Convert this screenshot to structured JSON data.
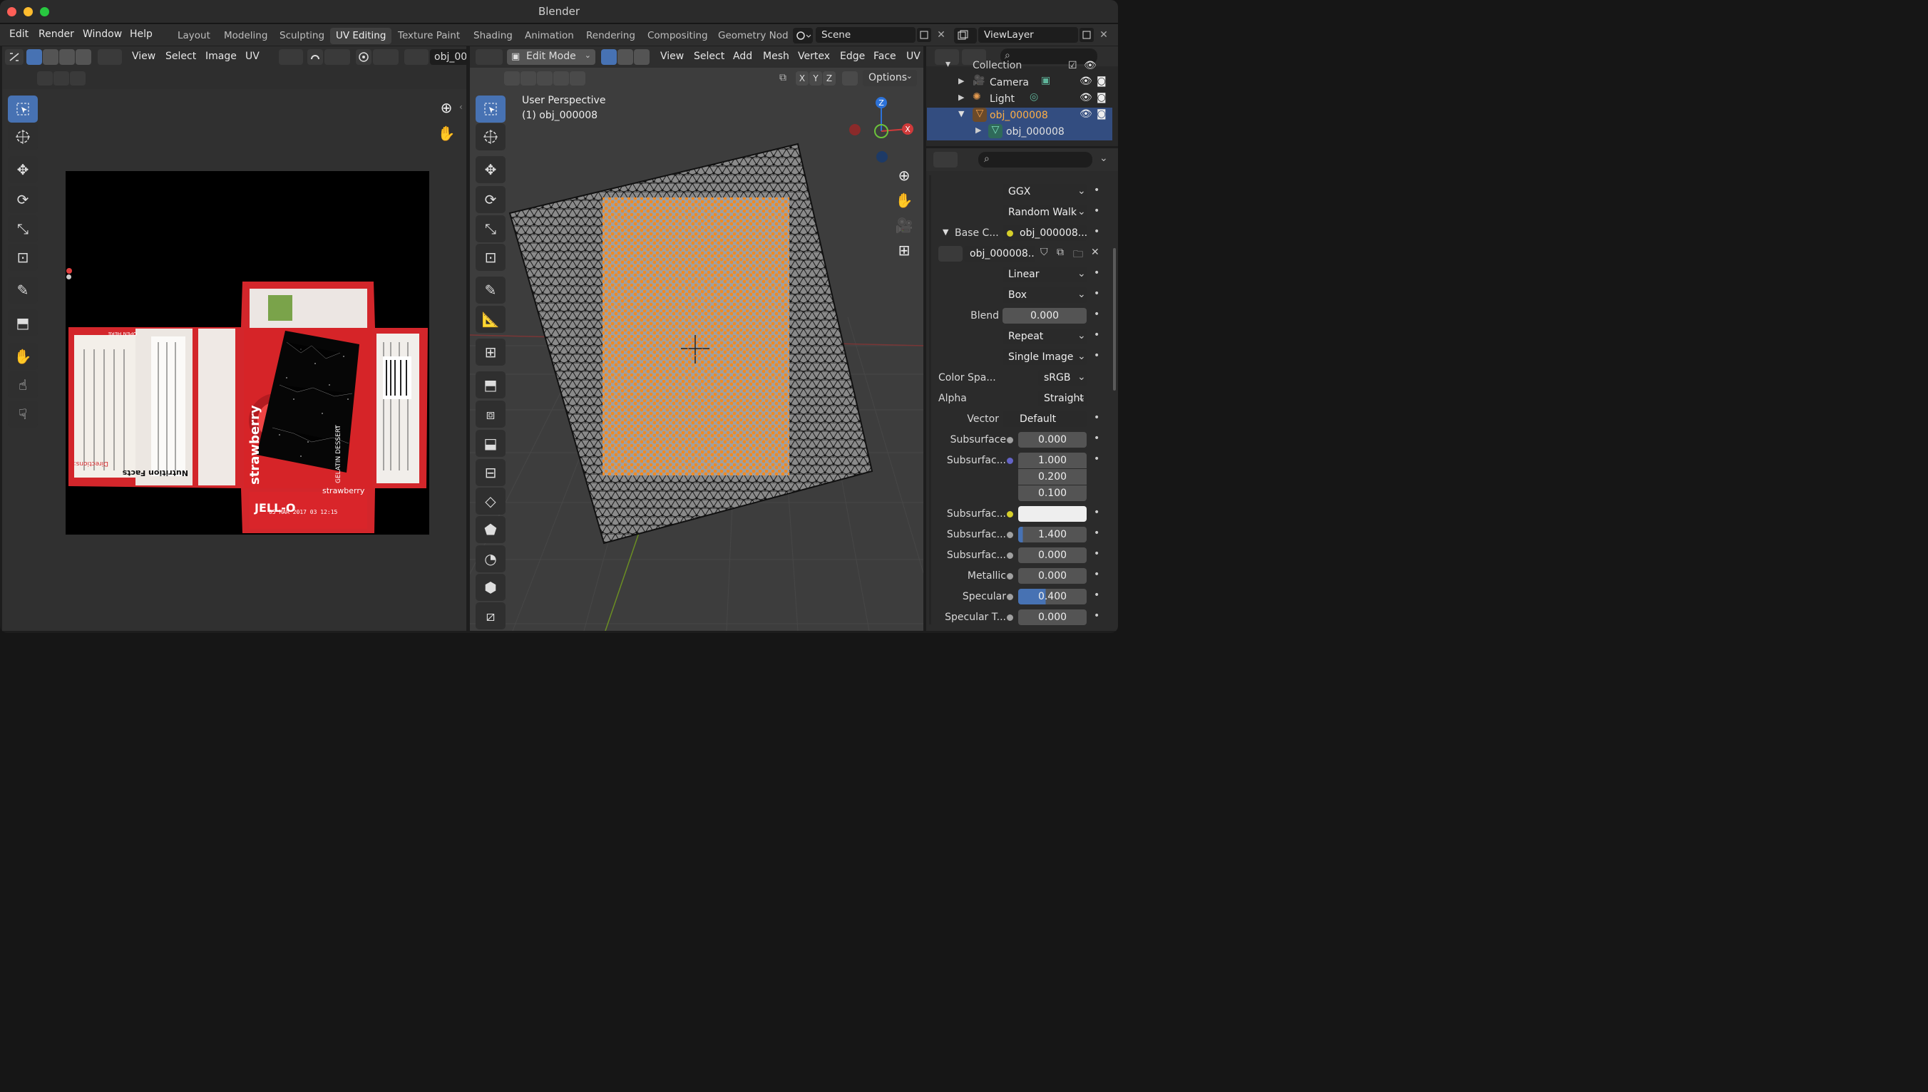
{
  "app": {
    "title": "Blender"
  },
  "menu": [
    "Edit",
    "Render",
    "Window",
    "Help"
  ],
  "workspaces": [
    {
      "label": "Layout",
      "active": false
    },
    {
      "label": "Modeling",
      "active": false
    },
    {
      "label": "Sculpting",
      "active": false
    },
    {
      "label": "UV Editing",
      "active": true
    },
    {
      "label": "Texture Paint",
      "active": false
    },
    {
      "label": "Shading",
      "active": false
    },
    {
      "label": "Animation",
      "active": false
    },
    {
      "label": "Rendering",
      "active": false
    },
    {
      "label": "Compositing",
      "active": false
    },
    {
      "label": "Geometry Nod",
      "active": false
    }
  ],
  "scene": {
    "name": "Scene"
  },
  "view_layer": {
    "name": "ViewLayer"
  },
  "uv_editor": {
    "menus": [
      "View",
      "Select",
      "Image",
      "UV"
    ],
    "image_name": "obj_000",
    "texture_labels": [
      "strawberry",
      "JELL-O",
      "strawberry",
      "Nutrition Facts",
      "05 MAR 2017 03 12:15",
      "GELATIN DESSERT",
      "Directions:",
      "OPEN HERE"
    ]
  },
  "viewport": {
    "mode": "Edit Mode",
    "menus": [
      "View",
      "Select",
      "Add",
      "Mesh",
      "Vertex",
      "Edge",
      "Face",
      "UV"
    ],
    "overlay_line1": "User Perspective",
    "overlay_line2": "(1) obj_000008",
    "axes": [
      "X",
      "Y",
      "Z"
    ],
    "options_label": "Options",
    "gizmo": {
      "z": "Z",
      "x": "X",
      "y": "Y"
    }
  },
  "outliner": {
    "items": [
      {
        "label": "Collection",
        "indent": 0
      },
      {
        "label": "Camera",
        "indent": 1
      },
      {
        "label": "Light",
        "indent": 1
      },
      {
        "label": "obj_000008",
        "indent": 1,
        "selected": true
      },
      {
        "label": "obj_000008",
        "indent": 2,
        "selected": true
      }
    ]
  },
  "properties": {
    "rows": [
      {
        "type": "dropdown",
        "label": "",
        "value": "GGX"
      },
      {
        "type": "dropdown",
        "label": "",
        "value": "Random Walk"
      },
      {
        "type": "link",
        "label": "Base C...",
        "value": "obj_000008...."
      },
      {
        "type": "image",
        "label": "",
        "value": "obj_000008...."
      },
      {
        "type": "dropdown",
        "label": "",
        "value": "Linear"
      },
      {
        "type": "dropdown",
        "label": "",
        "value": "Box"
      },
      {
        "type": "number",
        "label": "Blend",
        "value": "0.000"
      },
      {
        "type": "dropdown",
        "label": "",
        "value": "Repeat"
      },
      {
        "type": "dropdown",
        "label": "",
        "value": "Single Image"
      },
      {
        "type": "dropdown",
        "label": "Color Spa...",
        "value": "sRGB"
      },
      {
        "type": "dropdown",
        "label": "Alpha",
        "value": "Straight"
      },
      {
        "type": "link",
        "label": "Vector",
        "value": "Default"
      },
      {
        "type": "number",
        "label": "Subsurface",
        "value": "0.000"
      },
      {
        "type": "vector",
        "label": "Subsurfac...",
        "values": [
          "1.000",
          "0.200",
          "0.100"
        ]
      },
      {
        "type": "color",
        "label": "Subsurfac...",
        "value": "#eeeeee"
      },
      {
        "type": "slider",
        "label": "Subsurfac...",
        "value": "1.400",
        "fill": 0.07
      },
      {
        "type": "number",
        "label": "Subsurfac...",
        "value": "0.000"
      },
      {
        "type": "number",
        "label": "Metallic",
        "value": "0.000"
      },
      {
        "type": "slider",
        "label": "Specular",
        "value": "0.400",
        "fill": 0.4
      },
      {
        "type": "number",
        "label": "Specular T...",
        "value": "0.000"
      }
    ]
  },
  "colors": {
    "accent": "#4772b3",
    "selected_orange": "#ff8c1a",
    "header": "#2e2e2e",
    "panel": "#303030"
  }
}
